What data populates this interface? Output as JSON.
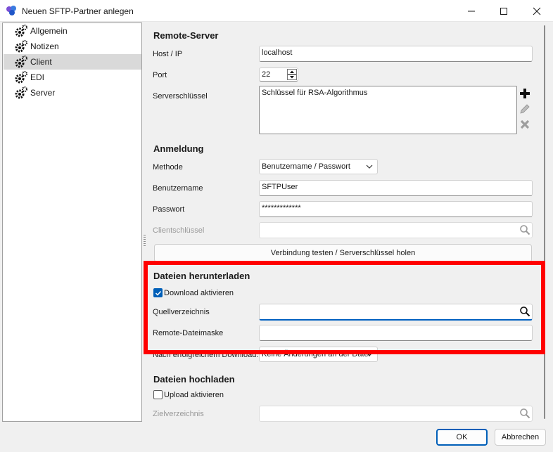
{
  "window": {
    "title": "Neuen SFTP-Partner anlegen",
    "minimize_glyph": "—",
    "maximize_glyph": "☐",
    "close_glyph": "✕"
  },
  "sidebar": {
    "items": [
      {
        "label": "Allgemein",
        "icon": "gear-icon",
        "selected": false
      },
      {
        "label": "Notizen",
        "icon": "gear-icon",
        "selected": false
      },
      {
        "label": "Client",
        "icon": "gear-icon",
        "selected": true
      },
      {
        "label": "EDI",
        "icon": "gear-icon",
        "selected": false
      },
      {
        "label": "Server",
        "icon": "gear-icon",
        "selected": false
      }
    ]
  },
  "remote_server": {
    "heading": "Remote-Server",
    "host_label": "Host / IP",
    "host_value": "localhost",
    "port_label": "Port",
    "port_value": "22",
    "serverkey_label": "Serverschlüssel",
    "serverkey_value": "Schlüssel für RSA-Algorithmus"
  },
  "login": {
    "heading": "Anmeldung",
    "method_label": "Methode",
    "method_value": "Benutzername / Passwort",
    "username_label": "Benutzername",
    "username_value": "SFTPUser",
    "password_label": "Passwort",
    "password_value": "*************",
    "clientkey_label": "Clientschlüssel",
    "clientkey_value": "",
    "test_button": "Verbindung testen / Serverschlüssel holen"
  },
  "download": {
    "heading": "Dateien herunterladen",
    "enable_label": "Download aktivieren",
    "enabled": true,
    "source_label": "Quellverzeichnis",
    "source_value": "",
    "mask_label": "Remote-Dateimaske",
    "mask_value": "",
    "after_label": "Nach erfolgreichem Download:",
    "after_value": "Keine Änderungen an der Datei"
  },
  "upload": {
    "heading": "Dateien hochladen",
    "enable_label": "Upload aktivieren",
    "enabled": false,
    "target_label": "Zielverzeichnis",
    "target_value": ""
  },
  "footer": {
    "ok_label": "OK",
    "cancel_label": "Abbrechen"
  },
  "colors": {
    "accent": "#005fb8",
    "highlight": "#ff0000",
    "selected_item": "#d9d9d9"
  }
}
